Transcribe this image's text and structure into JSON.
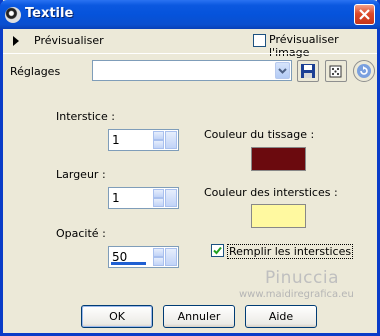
{
  "window": {
    "title": "Textile"
  },
  "preview": {
    "expand_label": "Prévisualiser",
    "preview_image_label": "Prévisualiser l'image",
    "preview_image_checked": false
  },
  "settings": {
    "label": "Réglages",
    "preset_value": ""
  },
  "params": {
    "interstice_label": "Interstice :",
    "interstice_value": "1",
    "largeur_label": "Largeur :",
    "largeur_value": "1",
    "opacite_label": "Opacité :",
    "opacite_value": "50",
    "opacite_fraction": 0.5,
    "weave_color_label": "Couleur du tissage :",
    "weave_color": "#6b0a0e",
    "gap_color_label": "Couleur des interstices :",
    "gap_color": "#fff9a0",
    "fill_gaps_label": "Remplir les interstices",
    "fill_gaps_checked": true
  },
  "watermark": {
    "line1": "Pinuccia",
    "line2": "www.maidiregrafica.eu"
  },
  "buttons": {
    "ok": "OK",
    "cancel": "Annuler",
    "help": "Aide"
  },
  "icons": {
    "app": "textile-effect-icon",
    "close": "close-icon",
    "save": "save-floppy-icon",
    "random": "dice-randomize-icon",
    "reset": "reset-icon"
  },
  "colors": {
    "titlebar": "#0553db",
    "dialog_bg": "#ece9d8",
    "accent": "#1f5fd2"
  }
}
